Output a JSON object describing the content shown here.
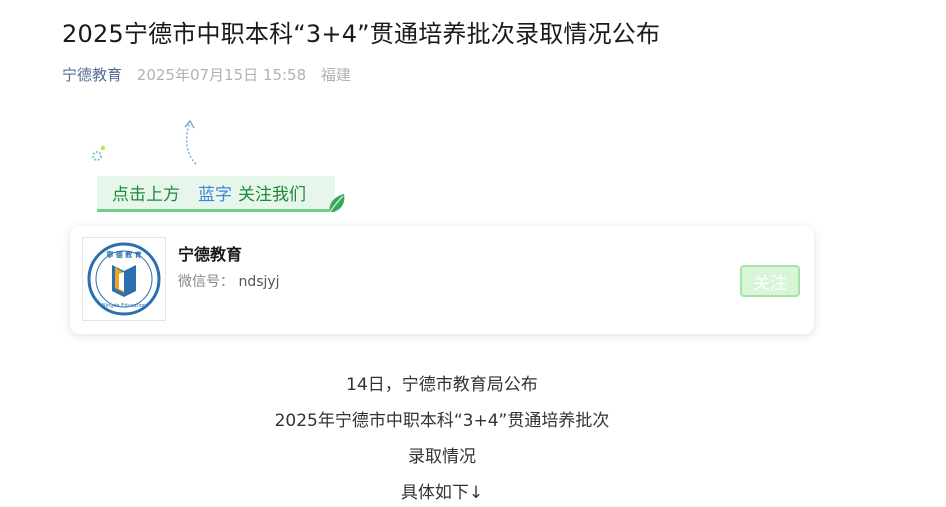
{
  "article": {
    "title": "2025宁德市中职本科“3+4”贯通培养批次录取情况公布",
    "author": "宁德教育",
    "date": "2025年07月15日 15:58",
    "region": "福建"
  },
  "follow_banner": {
    "text_left": "点击上方",
    "text_blue": "蓝字",
    "text_right": "关注我们",
    "colors": {
      "green": "#1f8a3a",
      "blue": "#3f86d6",
      "bg": "#e6f6ea"
    }
  },
  "account_card": {
    "name": "宁德教育",
    "wechat_id_label": "微信号：",
    "wechat_id": "ndsjyj",
    "follow_label": "关注",
    "logo_text": "宁德教育",
    "logo_subtext": "Ningde Education"
  },
  "content": {
    "lines": [
      "14日，宁德市教育局公布",
      "2025年宁德市中职本科“3+4”贯通培养批次",
      "录取情况",
      "具体如下↓"
    ]
  }
}
